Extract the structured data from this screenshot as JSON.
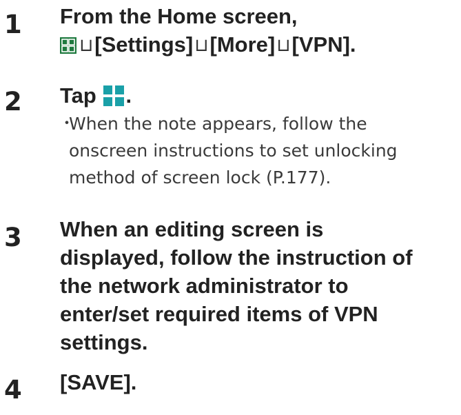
{
  "steps": [
    {
      "number": "1",
      "line1": "From the Home screen,",
      "menu_sep": "⊔",
      "menu_items": [
        "[Settings]",
        "[More]",
        "[VPN]."
      ],
      "apps_icon": "apps-grid-icon"
    },
    {
      "number": "2",
      "text_before": "Tap",
      "text_after": ".",
      "plus_icon": "add-plus-icon",
      "note_bullet": "・",
      "note_lines": [
        "When the note appears, follow the",
        "onscreen instructions to set unlocking",
        "method of screen lock (P.177)."
      ]
    },
    {
      "number": "3",
      "lines": [
        "When an editing screen is",
        "displayed, follow the instruction of",
        "the network administrator to",
        "enter/set required items of VPN",
        "settings."
      ]
    },
    {
      "number": "4",
      "text": "[SAVE]."
    }
  ],
  "colors": {
    "text": "#222222",
    "icon_green": "#1f7a3f",
    "icon_teal": "#1aa0a8"
  }
}
